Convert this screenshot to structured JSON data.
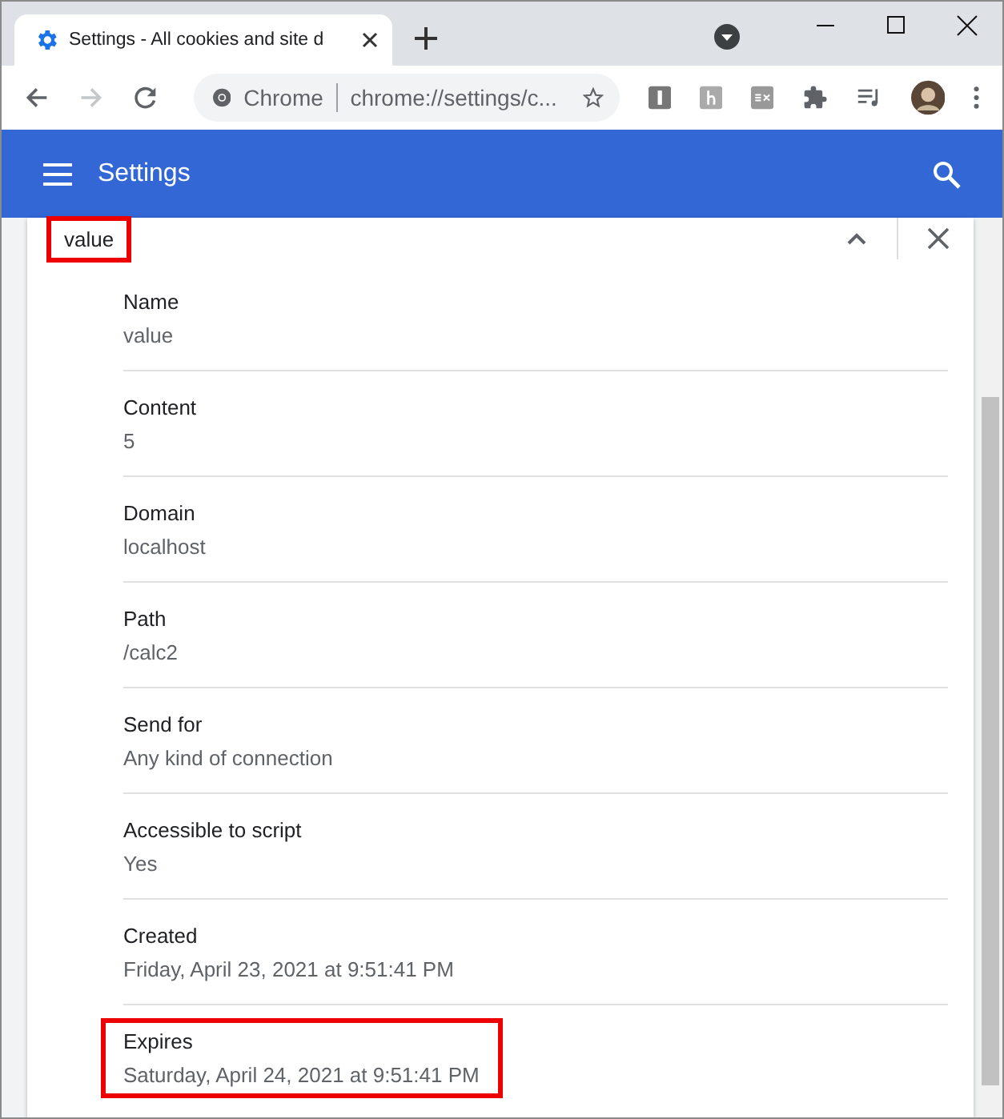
{
  "tab": {
    "title": "Settings - All cookies and site d",
    "selected": true
  },
  "address_bar": {
    "site_label": "Chrome",
    "url": "chrome://settings/c..."
  },
  "header": {
    "title": "Settings"
  },
  "cookie": {
    "title": "value",
    "highlighted": true
  },
  "fields": [
    {
      "label": "Name",
      "value": "value",
      "highlighted": false
    },
    {
      "label": "Content",
      "value": "5",
      "highlighted": false
    },
    {
      "label": "Domain",
      "value": "localhost",
      "highlighted": false
    },
    {
      "label": "Path",
      "value": "/calc2",
      "highlighted": false
    },
    {
      "label": "Send for",
      "value": "Any kind of connection",
      "highlighted": false
    },
    {
      "label": "Accessible to script",
      "value": "Yes",
      "highlighted": false
    },
    {
      "label": "Created",
      "value": "Friday, April 23, 2021 at 9:51:41 PM",
      "highlighted": false
    },
    {
      "label": "Expires",
      "value": "Saturday, April 24, 2021 at 9:51:41 PM",
      "highlighted": true
    }
  ]
}
